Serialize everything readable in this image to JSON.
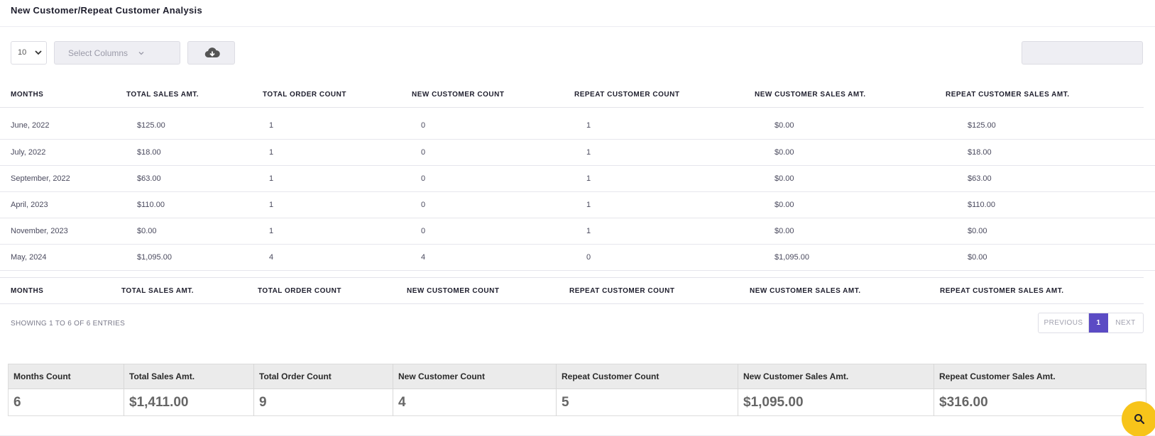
{
  "header": {
    "title": "New Customer/Repeat Customer Analysis"
  },
  "toolbar": {
    "page_length": "10",
    "columns_placeholder": "Select Columns",
    "download_icon": "cloud-download-icon",
    "search_value": ""
  },
  "table": {
    "columns": [
      "MONTHS",
      "TOTAL SALES AMT.",
      "TOTAL ORDER COUNT",
      "NEW CUSTOMER COUNT",
      "REPEAT CUSTOMER COUNT",
      "NEW CUSTOMER SALES AMT.",
      "REPEAT CUSTOMER SALES AMT."
    ],
    "rows": [
      [
        "June, 2022",
        "$125.00",
        "1",
        "0",
        "1",
        "$0.00",
        "$125.00"
      ],
      [
        "July, 2022",
        "$18.00",
        "1",
        "0",
        "1",
        "$0.00",
        "$18.00"
      ],
      [
        "September, 2022",
        "$63.00",
        "1",
        "0",
        "1",
        "$0.00",
        "$63.00"
      ],
      [
        "April, 2023",
        "$110.00",
        "1",
        "0",
        "1",
        "$0.00",
        "$110.00"
      ],
      [
        "November, 2023",
        "$0.00",
        "1",
        "0",
        "1",
        "$0.00",
        "$0.00"
      ],
      [
        "May, 2024",
        "$1,095.00",
        "4",
        "4",
        "0",
        "$1,095.00",
        "$0.00"
      ]
    ]
  },
  "pagination": {
    "info": "SHOWING 1 TO 6 OF 6 ENTRIES",
    "previous": "PREVIOUS",
    "current": "1",
    "next": "NEXT"
  },
  "summary": {
    "labels": [
      "Months Count",
      "Total Sales Amt.",
      "Total Order Count",
      "New Customer Count",
      "Repeat Customer Count",
      "New Customer Sales Amt.",
      "Repeat Customer Sales Amt."
    ],
    "values": [
      "6",
      "$1,411.00",
      "9",
      "4",
      "5",
      "$1,095.00",
      "$316.00"
    ]
  },
  "fab": {
    "icon": "search-icon",
    "color": "#f7c41a"
  },
  "colors": {
    "accent": "#5b4bc4"
  }
}
